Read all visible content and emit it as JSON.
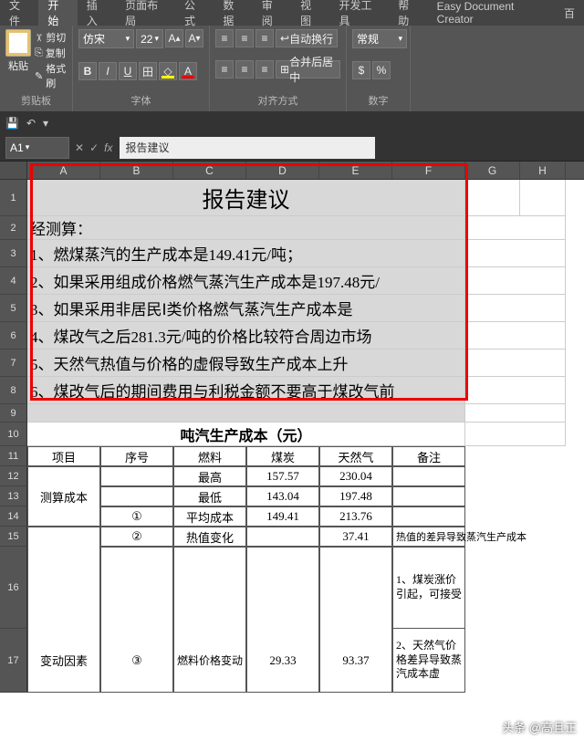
{
  "tabs": [
    "文件",
    "开始",
    "插入",
    "页面布局",
    "公式",
    "数据",
    "审阅",
    "视图",
    "开发工具",
    "帮助",
    "Easy Document Creator",
    "百"
  ],
  "active_tab_index": 1,
  "clipboard": {
    "paste": "粘贴",
    "cut": "剪切",
    "copy": "复制",
    "painter": "格式刷",
    "label": "剪贴板"
  },
  "font": {
    "name": "仿宋",
    "size": "22",
    "label": "字体"
  },
  "align": {
    "wrap": "自动换行",
    "merge": "合并后居中",
    "label": "对齐方式"
  },
  "number": {
    "format": "常规",
    "label": "数字"
  },
  "name_box": "A1",
  "formula": "报告建议",
  "columns": [
    "A",
    "B",
    "C",
    "D",
    "E",
    "F",
    "G",
    "H"
  ],
  "report": {
    "title": "报告建议",
    "lines": [
      "经测算：",
      "1、燃煤蒸汽的生产成本是149.41元/吨；",
      "2、如果采用组成价格燃气蒸汽生产成本是197.48元/",
      "3、如果采用非居民Ⅰ类价格燃气蒸汽生产成本是",
      "4、煤改气之后281.3元/吨的价格比较符合周边市场",
      "5、天然气热值与价格的虚假导致生产成本上升",
      "6、煤改气后的期间费用与利税金额不要高于煤改气前"
    ]
  },
  "table": {
    "title": "吨汽生产成本（元）",
    "headers": [
      "项目",
      "序号",
      "燃料",
      "煤炭",
      "天然气",
      "备注"
    ],
    "rows": [
      {
        "project": "测算成本",
        "seq": "",
        "fuel": "最高",
        "coal": "157.57",
        "gas": "230.04",
        "note": ""
      },
      {
        "project": "",
        "seq": "",
        "fuel": "最低",
        "coal": "143.04",
        "gas": "197.48",
        "note": ""
      },
      {
        "project": "",
        "seq": "①",
        "fuel": "平均成本",
        "coal": "149.41",
        "gas": "213.76",
        "note": ""
      },
      {
        "project": "",
        "seq": "②",
        "fuel": "热值变化",
        "coal": "",
        "gas": "37.41",
        "note": "热值的差异导致蒸汽生产成本"
      },
      {
        "project": "变动因素",
        "seq": "③",
        "fuel": "燃料价格变动",
        "coal": "29.33",
        "gas": "93.37",
        "note": "1、煤炭涨价引起，可接受\n2、天然气价格差异导致蒸汽成本虚"
      }
    ]
  },
  "watermark": "头条 @高且正"
}
